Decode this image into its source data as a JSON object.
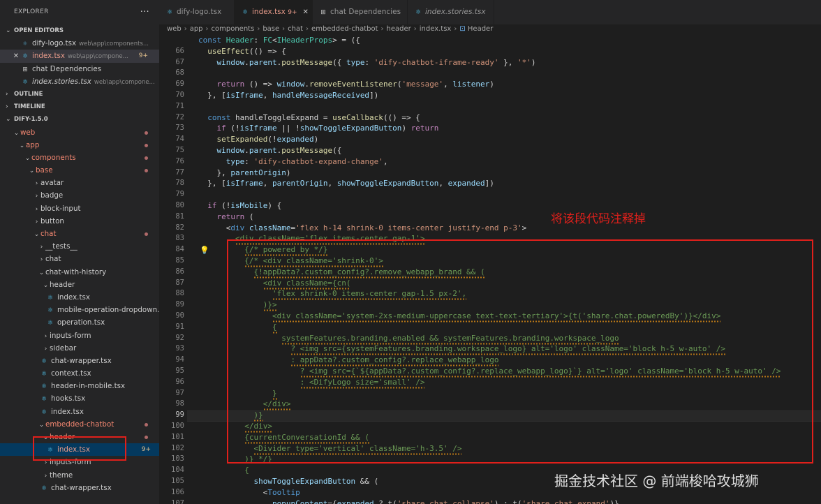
{
  "sidebar": {
    "title": "EXPLORER",
    "more": "···",
    "open_editors_label": "OPEN EDITORS",
    "open_editors": [
      {
        "name": "dify-logo.tsx",
        "path": "web\\app\\components...",
        "badge": "",
        "close": ""
      },
      {
        "name": "index.tsx",
        "path": "web\\app\\compone...",
        "badge": "9+",
        "close": "✕"
      },
      {
        "name": "chat Dependencies",
        "path": "",
        "badge": "",
        "close": ""
      },
      {
        "name": "index.stories.tsx",
        "path": "web\\app\\compone...",
        "badge": "",
        "close": ""
      }
    ],
    "outline_label": "OUTLINE",
    "timeline_label": "TIMELINE",
    "project_label": "DIFY-1.5.0",
    "tree": [
      {
        "label": "web",
        "type": "folder-open"
      },
      {
        "label": "app",
        "type": "folder-open"
      },
      {
        "label": "components",
        "type": "folder-open"
      },
      {
        "label": "base",
        "type": "folder-open"
      },
      {
        "label": "avatar",
        "type": "folder"
      },
      {
        "label": "badge",
        "type": "folder"
      },
      {
        "label": "block-input",
        "type": "folder"
      },
      {
        "label": "button",
        "type": "folder"
      },
      {
        "label": "chat",
        "type": "folder-open"
      },
      {
        "label": "__tests__",
        "type": "folder"
      },
      {
        "label": "chat",
        "type": "folder"
      },
      {
        "label": "chat-with-history",
        "type": "folder-open"
      },
      {
        "label": "header",
        "type": "folder-open"
      },
      {
        "label": "index.tsx",
        "type": "file"
      },
      {
        "label": "mobile-operation-dropdown...",
        "type": "file"
      },
      {
        "label": "operation.tsx",
        "type": "file"
      },
      {
        "label": "inputs-form",
        "type": "folder"
      },
      {
        "label": "sidebar",
        "type": "folder"
      },
      {
        "label": "chat-wrapper.tsx",
        "type": "file"
      },
      {
        "label": "context.tsx",
        "type": "file"
      },
      {
        "label": "header-in-mobile.tsx",
        "type": "file"
      },
      {
        "label": "hooks.tsx",
        "type": "file"
      },
      {
        "label": "index.tsx",
        "type": "file"
      },
      {
        "label": "embedded-chatbot",
        "type": "folder-open"
      },
      {
        "label": "header",
        "type": "folder-open"
      },
      {
        "label": "index.tsx",
        "type": "file",
        "badge": "9+"
      },
      {
        "label": "inputs-form",
        "type": "folder"
      },
      {
        "label": "theme",
        "type": "folder"
      },
      {
        "label": "chat-wrapper.tsx",
        "type": "file"
      }
    ]
  },
  "tabs": [
    {
      "label": "dify-logo.tsx",
      "badge": ""
    },
    {
      "label": "index.tsx",
      "badge": "9+"
    },
    {
      "label": "chat Dependencies",
      "badge": ""
    },
    {
      "label": "index.stories.tsx",
      "badge": ""
    }
  ],
  "tab_close": "✕",
  "breadcrumb": [
    "web",
    "app",
    "components",
    "base",
    "chat",
    "embedded-chatbot",
    "header",
    "index.tsx",
    "Header"
  ],
  "editor": {
    "first_line": 66,
    "current_line": 99,
    "header_line": "const Header: FC<IHeaderProps> = ({",
    "lines": [
      "  useEffect(() => {",
      "    window.parent.postMessage({ type: 'dify-chatbot-iframe-ready' }, '*')",
      "",
      "    return () => window.removeEventListener('message', listener)",
      "  }, [isIframe, handleMessageReceived])",
      "",
      "  const handleToggleExpand = useCallback(() => {",
      "    if (!isIframe || !showToggleExpandButton) return",
      "    setExpanded(!expanded)",
      "    window.parent.postMessage({",
      "      type: 'dify-chatbot-expand-change',",
      "    }, parentOrigin)",
      "  }, [isIframe, parentOrigin, showToggleExpandButton, expanded])",
      "",
      "  if (!isMobile) {",
      "    return (",
      "      <div className='flex h-14 shrink-0 items-center justify-end p-3'>",
      "        <div className='flex items-center gap-1'>",
      "          {/* powered by */}",
      "          {/* <div className='shrink-0'>",
      "            {!appData?.custom_config?.remove_webapp_brand && (",
      "              <div className={cn(",
      "                'flex shrink-0 items-center gap-1.5 px-2',",
      "              )}>",
      "                <div className='system-2xs-medium-uppercase text-text-tertiary'>{t('share.chat.poweredBy')}</div>",
      "                {",
      "                  systemFeatures.branding.enabled && systemFeatures.branding.workspace_logo",
      "                    ? <img src={systemFeatures.branding.workspace_logo} alt='logo' className='block h-5 w-auto' />",
      "                    : appData?.custom_config?.replace_webapp_logo",
      "                      ? <img src={`${appData?.custom_config?.replace_webapp_logo}`} alt='logo' className='block h-5 w-auto' />",
      "                      : <DifyLogo size='small' />",
      "                }",
      "              </div>",
      "            )}",
      "          </div>",
      "          {currentConversationId && (",
      "            <Divider type='vertical' className='h-3.5' />",
      "          )} */}",
      "          {",
      "            showToggleExpandButton && (",
      "              <Tooltip",
      "                popupContent={expanded ? t('share.chat.collapse') : t('share.chat.expand')}"
    ]
  },
  "annotation": "将该段代码注释掉",
  "watermark": "掘金技术社区 @ 前端梭哈攻城狮"
}
